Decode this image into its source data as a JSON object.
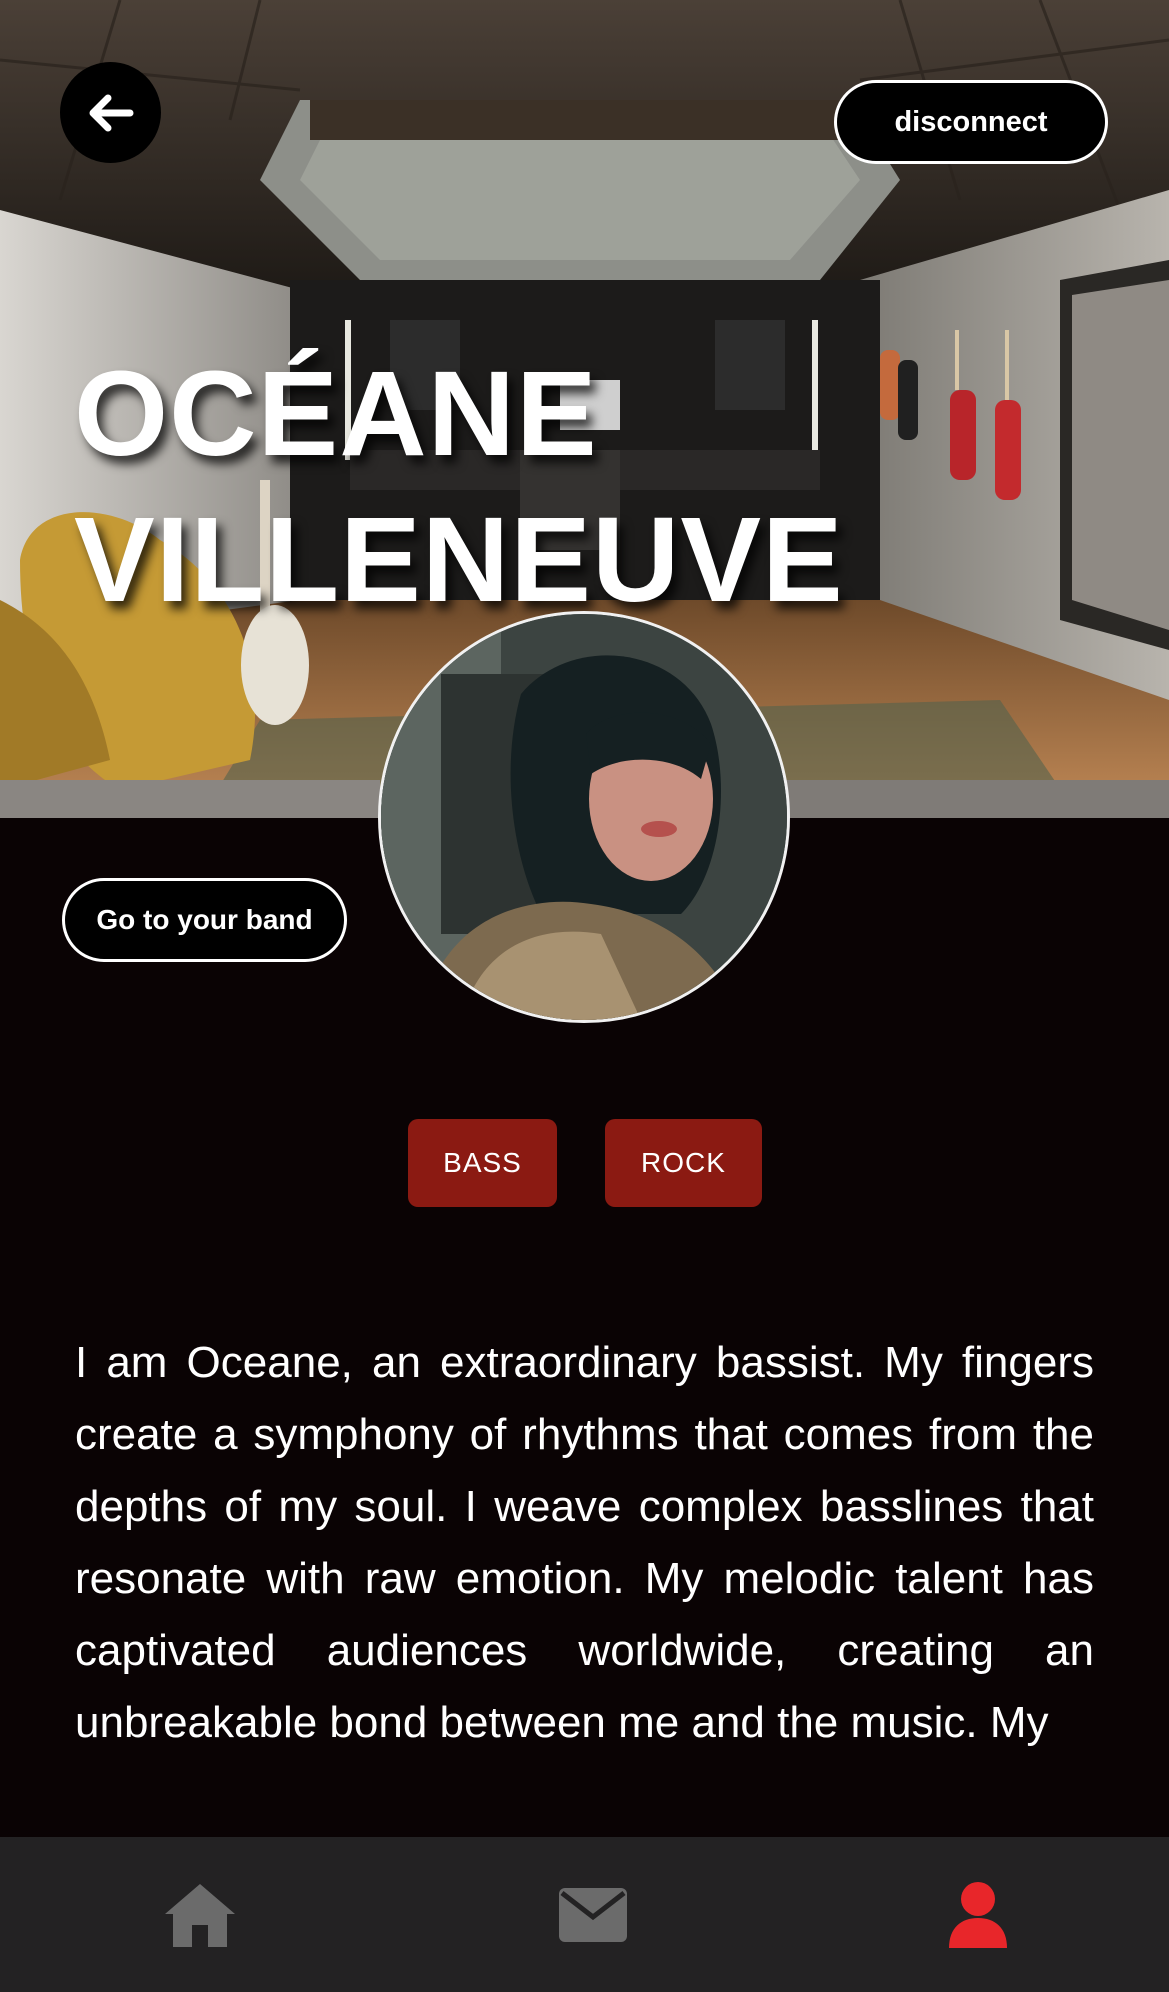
{
  "header": {
    "back_icon": "arrow-left-icon",
    "disconnect_label": "disconnect"
  },
  "profile": {
    "first_name": "OCÉANE",
    "last_name": "VILLENEUVE",
    "band_button_label": "Go to your band",
    "tags": [
      "BASS",
      "ROCK"
    ],
    "bio": "I am Oceane, an extraordinary bassist. My fingers create a symphony of rhythms that comes from the depths of my soul. I weave complex basslines that resonate with raw emotion. My melodic talent has captivated audiences worldwide, creating an unbreakable bond between me and the music. My"
  },
  "nav": {
    "items": [
      {
        "icon": "home-icon",
        "active": false
      },
      {
        "icon": "mail-icon",
        "active": false
      },
      {
        "icon": "user-icon",
        "active": true
      }
    ]
  },
  "colors": {
    "background": "#0a0304",
    "tag": "#8b1a12",
    "nav_bg": "#232223",
    "nav_icon": "#6b6b6b",
    "nav_active": "#e8262a"
  }
}
